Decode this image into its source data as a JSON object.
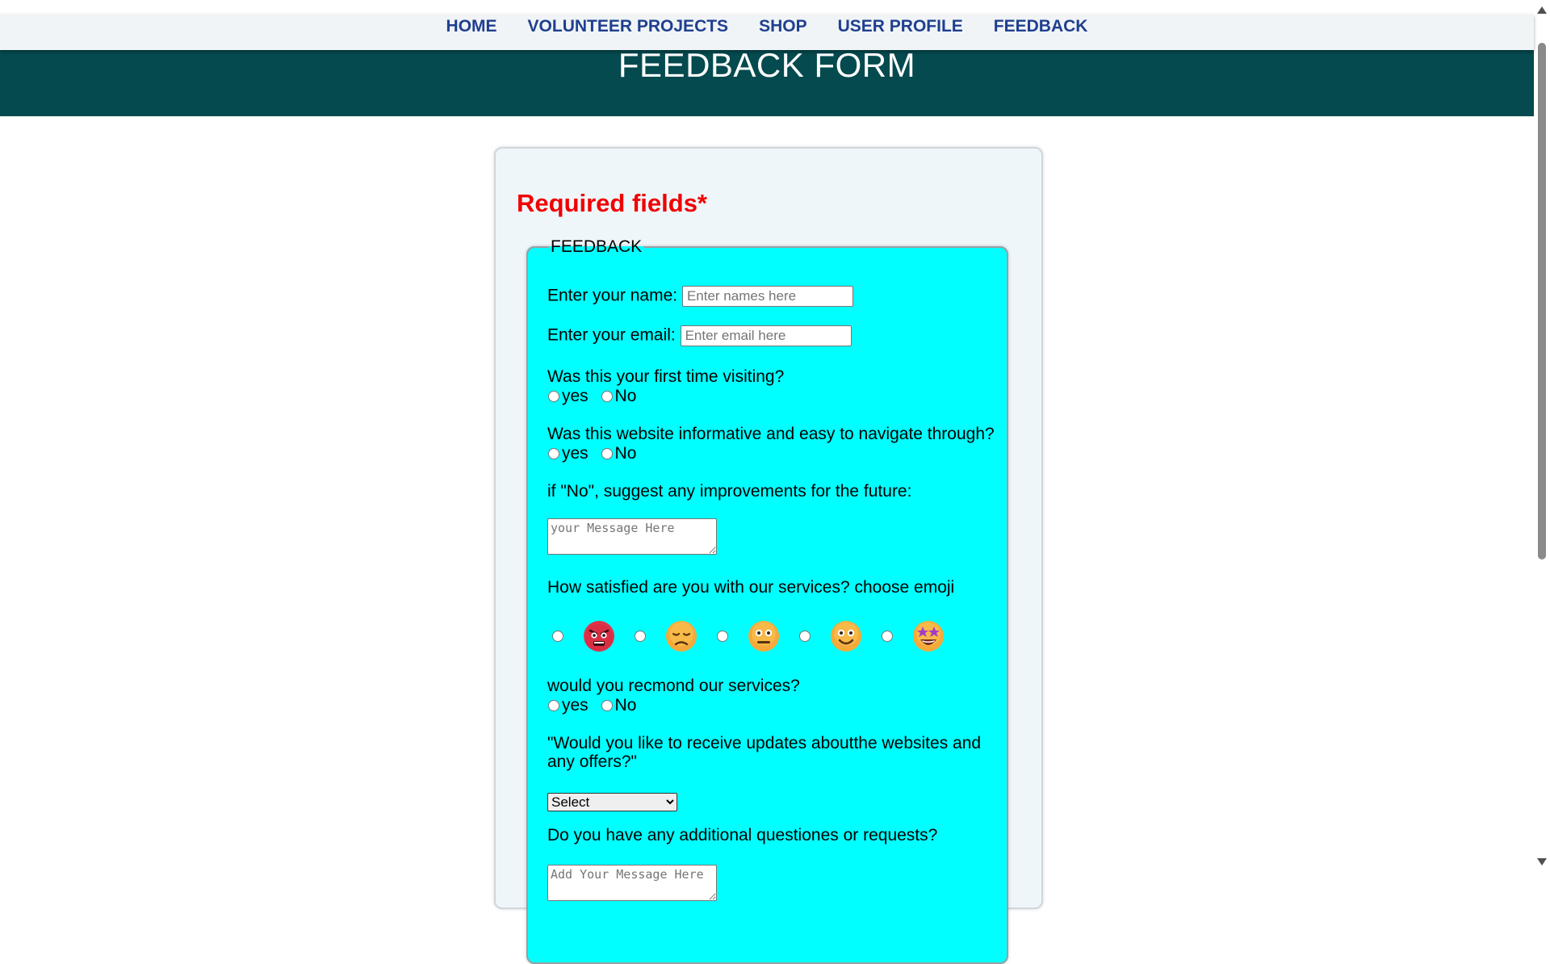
{
  "nav": {
    "items": [
      "HOME",
      "VOLUNTEER PROJECTS",
      "SHOP",
      "USER PROFILE",
      "FEEDBACK"
    ]
  },
  "banner": {
    "title": "FEEDBACK FORM"
  },
  "form": {
    "required_label": "Required fields*",
    "legend": "FEEDBACK",
    "name": {
      "label": "Enter your name:",
      "placeholder": "Enter names here"
    },
    "email": {
      "label": "Enter your email:",
      "placeholder": "Enter email here"
    },
    "q_first_visit": {
      "label": "Was this your first time visiting?",
      "yes": "yes",
      "no": "No"
    },
    "q_informative": {
      "label": "Was this website informative and easy to navigate through?",
      "yes": "yes",
      "no": "No"
    },
    "improvements": {
      "label": "if \"No\", suggest any improvements for the future:",
      "placeholder": "your Message Here"
    },
    "satisfaction": {
      "label": "How satisfied are you with our services? choose emoji",
      "emojis": [
        "angry-face-icon",
        "sad-face-icon",
        "neutral-face-icon",
        "happy-face-icon",
        "star-struck-face-icon"
      ]
    },
    "q_recommend": {
      "label": "would you recmond our services?",
      "yes": "yes",
      "no": "No"
    },
    "updates": {
      "label": "\"Would you like to receive updates aboutthe websites and any offers?\"",
      "selected": "Select"
    },
    "additional": {
      "label": "Do you have any additional questiones or requests?",
      "placeholder": "Add Your Message Here"
    }
  },
  "colors": {
    "nav_text": "#1f3f8f",
    "banner": "#044a4e",
    "required": "#f00000",
    "fieldset_bg": "#00ffff"
  }
}
